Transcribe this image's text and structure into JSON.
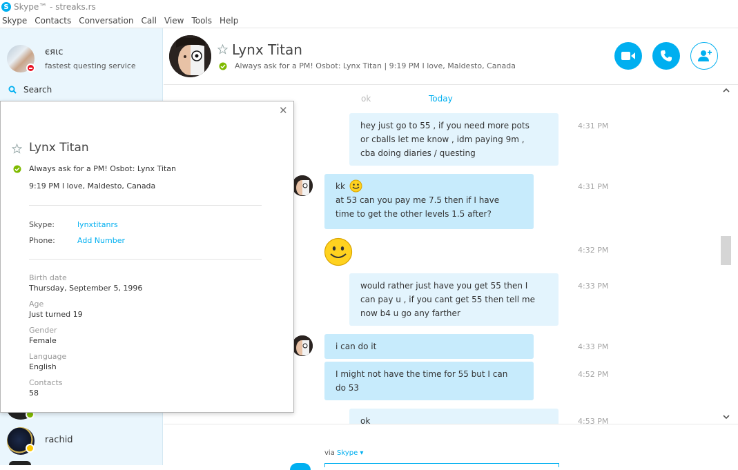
{
  "window": {
    "title": "Skype™ - streaks.rs"
  },
  "menu": [
    "Skype",
    "Contacts",
    "Conversation",
    "Call",
    "View",
    "Tools",
    "Help"
  ],
  "me": {
    "name": "єяιc",
    "mood": "fastest questing service",
    "status": "do-not-disturb"
  },
  "search": {
    "label": "Search"
  },
  "contacts": [
    {
      "name": "rachid",
      "status": "away"
    }
  ],
  "conversation": {
    "name": "Lynx Titan",
    "mood_line": "Always ask for a PM! Osbot: Lynx Titan  |  9:19 PM I love, Maldesto, Canada",
    "date_separator": "Today",
    "ghost_message": "ok",
    "messages": [
      {
        "dir": "out",
        "lines": [
          "hey just go to 55 , if you need more pots",
          "or cballs let me know , idm paying 9m ,",
          "cba doing diaries / questing"
        ],
        "time": "4:31 PM"
      },
      {
        "dir": "in",
        "lines": [
          "kk",
          "at 53 can you pay me 7.5 then if I have",
          "time to get the other levels 1.5 after?"
        ],
        "time": "4:31 PM",
        "emoticon": "smile"
      },
      {
        "dir": "in",
        "lines": [],
        "time": "4:32 PM",
        "emoticon": "big-smile"
      },
      {
        "dir": "out",
        "lines": [
          "would rather just have you get 55 then I",
          "can pay u , if you cant get 55 then tell me",
          "now b4 u go any farther"
        ],
        "time": "4:33 PM"
      },
      {
        "dir": "in",
        "lines": [
          "i can do it"
        ],
        "time": "4:33 PM"
      },
      {
        "dir": "in",
        "lines": [
          "I might not have the time for 55 but I can",
          "do 53"
        ],
        "time": "4:52 PM"
      },
      {
        "dir": "out",
        "lines": [
          "ok"
        ],
        "time": "4:53 PM"
      }
    ]
  },
  "composer": {
    "via_label": "via",
    "via_service": "Skype"
  },
  "profile": {
    "name": "Lynx Titan",
    "mood": "Always ask for a PM! Osbot: Lynx Titan",
    "location": "9:19 PM I love, Maldesto, Canada",
    "skype_label": "Skype:",
    "skype_value": "lynxtitanrs",
    "phone_label": "Phone:",
    "phone_value": "Add Number",
    "details": [
      {
        "label": "Birth date",
        "value": "Thursday, September 5, 1996"
      },
      {
        "label": "Age",
        "value": "Just turned 19"
      },
      {
        "label": "Gender",
        "value": "Female"
      },
      {
        "label": "Language",
        "value": "English"
      },
      {
        "label": "Contacts",
        "value": "58"
      }
    ]
  },
  "colors": {
    "accent": "#00aff0",
    "online": "#7fba00",
    "dnd": "#e81123",
    "away": "#fdc800"
  }
}
